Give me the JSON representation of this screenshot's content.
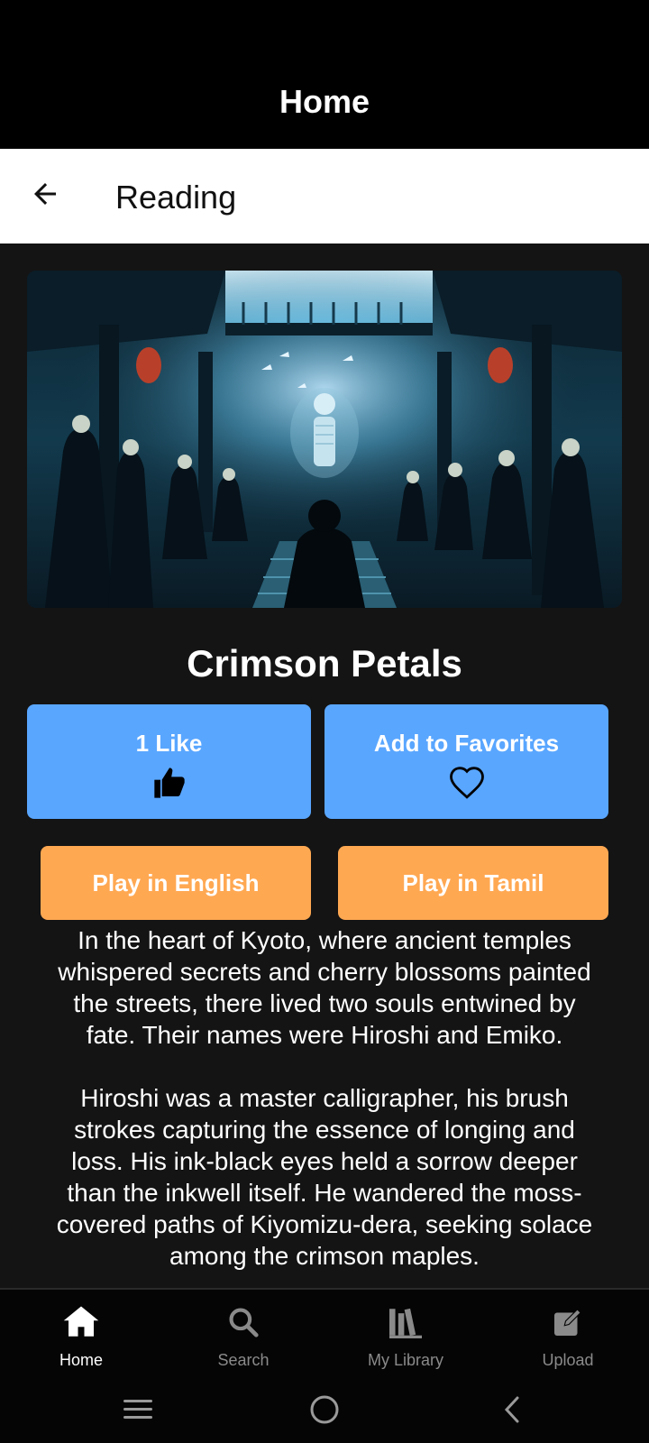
{
  "app_bar": {
    "title": "Home"
  },
  "header": {
    "back_icon": "arrow-left-icon",
    "title": "Reading"
  },
  "story": {
    "title": "Crimson Petals",
    "paragraphs": [
      "In the heart of Kyoto, where ancient temples whispered secrets and cherry blossoms painted the streets, there lived two souls entwined by fate. Their names were Hiroshi and Emiko.",
      "Hiroshi was a master calligrapher, his brush strokes capturing the essence of longing and loss. His ink-black eyes held a sorrow deeper than the inkwell itself. He wandered the moss-covered paths of Kiyomizu-dera, seeking solace among the crimson maples."
    ]
  },
  "actions": {
    "like_label": "1 Like",
    "like_icon": "thumbs-up-icon",
    "favorite_label": "Add to Favorites",
    "favorite_icon": "heart-outline-icon",
    "play_english": "Play in English",
    "play_tamil": "Play in Tamil"
  },
  "bottom_nav": {
    "items": [
      {
        "label": "Home",
        "icon": "home-icon",
        "active": true
      },
      {
        "label": "Search",
        "icon": "search-icon",
        "active": false
      },
      {
        "label": "My Library",
        "icon": "library-icon",
        "active": false
      },
      {
        "label": "Upload",
        "icon": "upload-edit-icon",
        "active": false
      }
    ]
  },
  "colors": {
    "background": "#141414",
    "primary_button": "#59a6ff",
    "secondary_button": "#ffa852",
    "bar": "#000000"
  }
}
